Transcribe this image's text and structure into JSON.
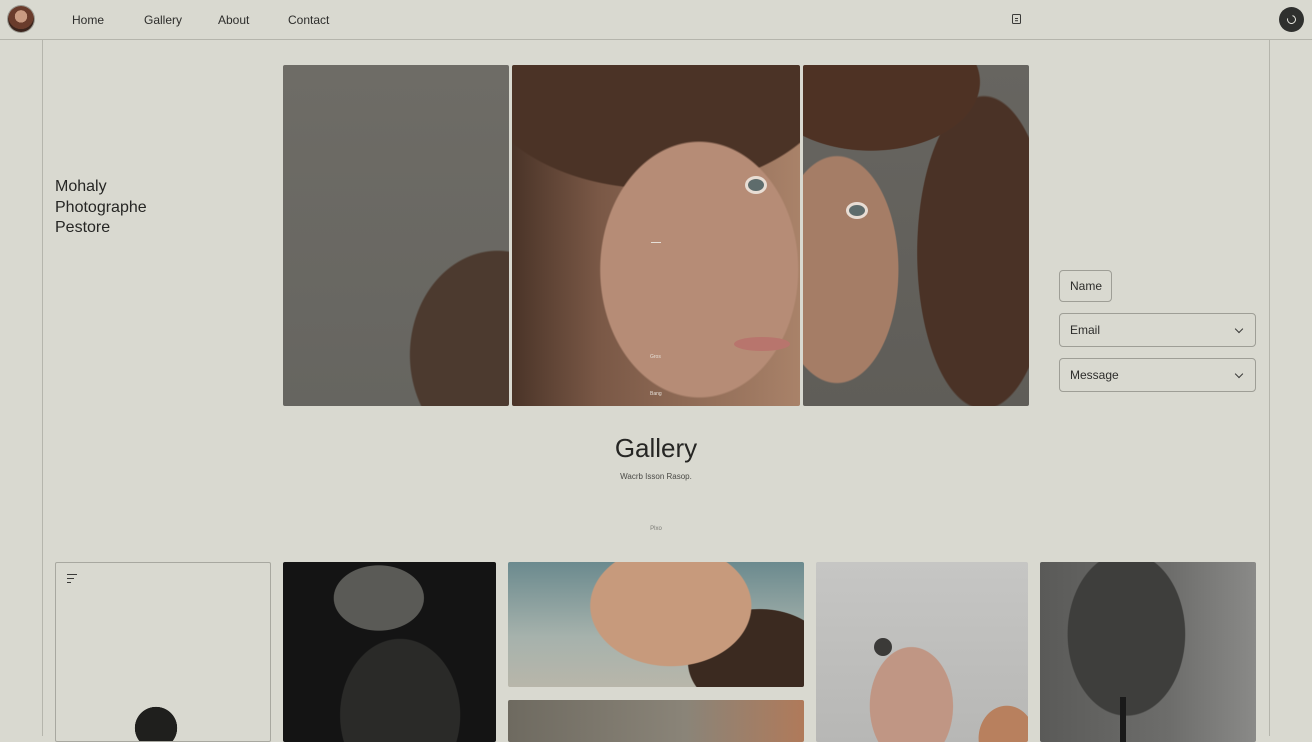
{
  "nav": {
    "items": [
      {
        "label": "Home"
      },
      {
        "label": "Gallery"
      },
      {
        "label": "About"
      },
      {
        "label": "Contact"
      }
    ]
  },
  "hero": {
    "lines": [
      "Mohaly",
      "Photographe",
      "Pestore"
    ],
    "photo_caption_1": "Gros",
    "photo_caption_2": "Bang"
  },
  "contact_form": {
    "name_label": "Name",
    "email_label": "Email",
    "message_label": "Message"
  },
  "gallery": {
    "title": "Gallery",
    "subtitle": "Wacrb Isson Rasop.",
    "small_label": "Plxo"
  },
  "icons": {
    "avatar": "profile-photo",
    "document": "document-icon",
    "profile": "profile-icon",
    "filter": "filter-icon",
    "chevron": "chevron-down-icon"
  },
  "colors": {
    "background": "#d9d9d0",
    "text": "#2a2a28",
    "border": "#9e9e96",
    "button_dark": "#2f302e"
  }
}
